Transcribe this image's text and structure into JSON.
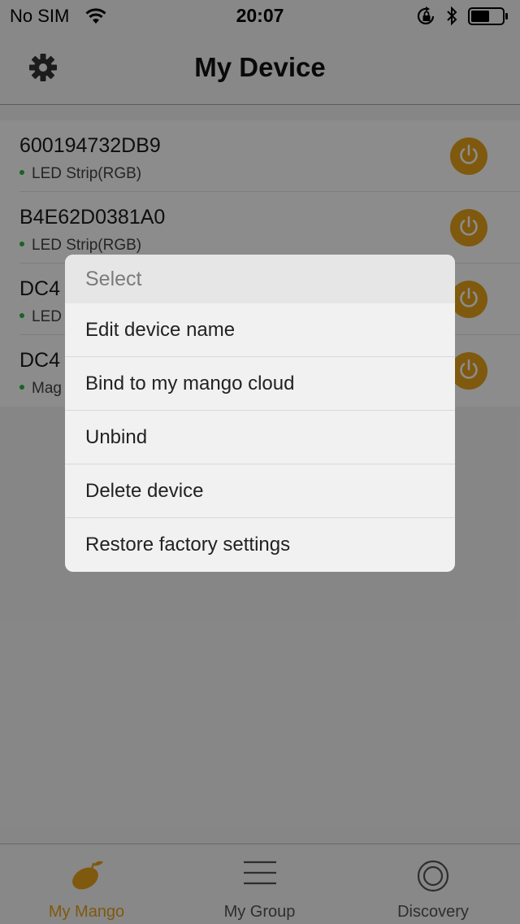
{
  "status_bar": {
    "carrier": "No SIM",
    "time": "20:07"
  },
  "nav": {
    "title": "My Device",
    "settings_icon": "gear-icon"
  },
  "devices": [
    {
      "name": "600194732DB9",
      "type": "LED Strip(RGB)"
    },
    {
      "name": "B4E62D0381A0",
      "type": "LED Strip(RGB)"
    },
    {
      "name": "DC4",
      "type": "LED"
    },
    {
      "name": "DC4",
      "type": "Mag"
    }
  ],
  "dialog": {
    "title": "Select",
    "options": [
      "Edit device name",
      "Bind to my mango cloud",
      "Unbind",
      "Delete device",
      "Restore factory settings"
    ]
  },
  "tabs": [
    {
      "label": "My Mango",
      "icon": "mango-icon",
      "active": true
    },
    {
      "label": "My Group",
      "icon": "list-icon",
      "active": false
    },
    {
      "label": "Discovery",
      "icon": "discovery-icon",
      "active": false
    }
  ],
  "colors": {
    "accent": "#e8a21a",
    "online_dot": "#29b34a"
  }
}
